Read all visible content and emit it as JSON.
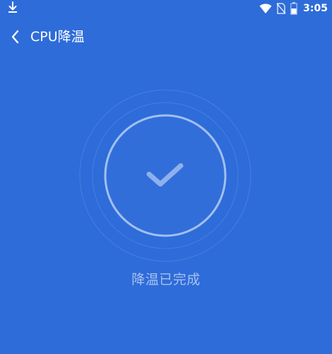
{
  "status_bar": {
    "time": "3:05",
    "icons": [
      "download-icon",
      "wifi-icon",
      "no-sim-icon",
      "battery-icon"
    ]
  },
  "header": {
    "back_icon": "chevron-left-icon",
    "title": "CPU降温"
  },
  "main": {
    "status_icon": "checkmark-icon",
    "result_text": "降温已完成"
  },
  "colors": {
    "background": "#2e6cd9",
    "ring": "#9fbcef",
    "check": "#8eb0ec",
    "result_text": "#a8c2ee"
  }
}
